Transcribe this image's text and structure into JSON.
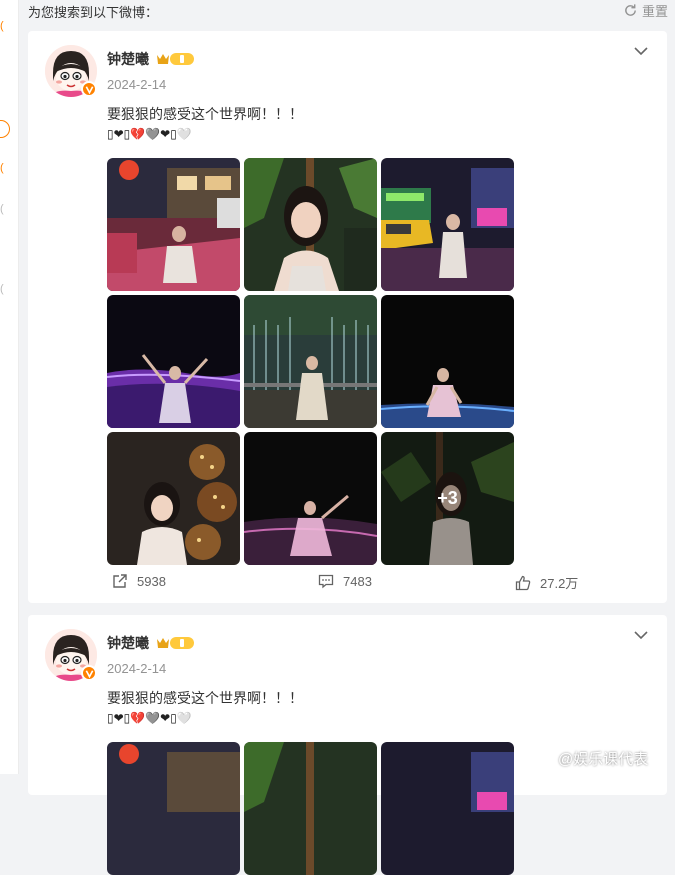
{
  "header": {
    "hint": "为您搜索到以下微博：",
    "reset_label": "重置"
  },
  "posts": [
    {
      "username": "钟楚曦",
      "date": "2024-2-14",
      "text": "要狠狠的感受这个世界啊！！！",
      "emoji_line": "▯❤▯💔🩶❤▯🤍",
      "more_count": "+3",
      "repost_count": "5938",
      "comment_count": "7483",
      "like_count": "27.2万"
    },
    {
      "username": "钟楚曦",
      "date": "2024-2-14",
      "text": "要狠狠的感受这个世界啊！！！",
      "emoji_line": "▯❤▯💔🩶❤▯🤍"
    }
  ],
  "watermark": "@娱乐课代表",
  "colors": {
    "accent": "#ff8200",
    "muted": "#939393",
    "background": "#f2f3f5"
  }
}
